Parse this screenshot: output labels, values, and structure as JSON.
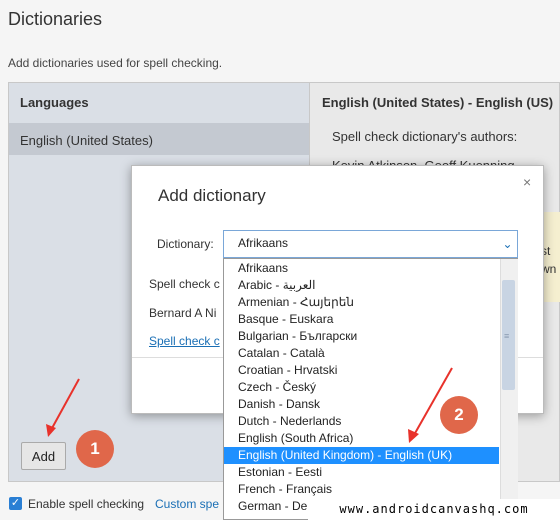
{
  "page": {
    "title": "Dictionaries",
    "subtitle": "Add dictionaries used for spell checking."
  },
  "languages": {
    "header": "Languages",
    "items": [
      "English (United States)"
    ],
    "add_label": "Add"
  },
  "detail": {
    "header": "English (United States) - English (US)",
    "authors_label": "Spell check dictionary's authors:",
    "authors_names": "Kevin Atkinson, Geoff Kuenning",
    "fragment_st": "st",
    "fragment_wn": "wn"
  },
  "footer": {
    "enable_label": "Enable spell checking",
    "custom_link": "Custom spe",
    "checkbox_mark": "✓"
  },
  "modal": {
    "title": "Add dictionary",
    "close_glyph": "×",
    "dictionary_label": "Dictionary:",
    "selected_value": "Afrikaans",
    "spell_check_fragment": "Spell check c",
    "author_fragment": "Bernard A Ni",
    "link_fragment": "Spell check c",
    "arrow_glyph": "⌄",
    "options": [
      "Afrikaans",
      "Arabic - العربية",
      "Armenian - Հայերեն",
      "Basque - Euskara",
      "Bulgarian - Български",
      "Catalan - Català",
      "Croatian - Hrvatski",
      "Czech - Český",
      "Danish - Dansk",
      "Dutch - Nederlands",
      "English (South Africa)",
      "English (United Kingdom) - English (UK)",
      "Estonian - Eesti",
      "French - Français",
      "German - Deutsch"
    ],
    "highlighted_index": 11
  },
  "annotations": {
    "badge_1": "1",
    "badge_2": "2",
    "badge_color": "#e0674a",
    "arrow_color": "#e8322b"
  },
  "watermark": "www.androidcanvashq.com",
  "colors": {
    "selection": "#1e90ff",
    "link": "#1a6fb5"
  }
}
